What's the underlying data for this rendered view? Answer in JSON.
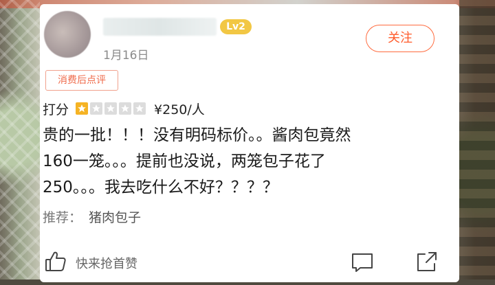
{
  "user": {
    "level": "Lv2",
    "date": "1月16日"
  },
  "follow": {
    "label": "关注"
  },
  "tag": {
    "label": "消费后点评"
  },
  "rating": {
    "label": "打分",
    "stars_filled": 1,
    "stars_total": 5,
    "price": "¥250/人"
  },
  "review": {
    "text": "贵的一批！！！没有明码标价。。酱肉包竟然\n160一笼。。。提前也没说，两笼包子花了\n250。。。我去吃什么不好？？？？"
  },
  "recommend": {
    "label": "推荐：",
    "value": "猪肉包子"
  },
  "actions": {
    "like_label": "快来抢首赞",
    "like_icon": "thumbs-up-icon",
    "comment_icon": "comment-icon",
    "share_icon": "share-icon"
  },
  "colors": {
    "accent": "#ff5a2a",
    "badge": "#f2c744",
    "star_on": "#f5b324",
    "star_off": "#dcdcdc"
  }
}
